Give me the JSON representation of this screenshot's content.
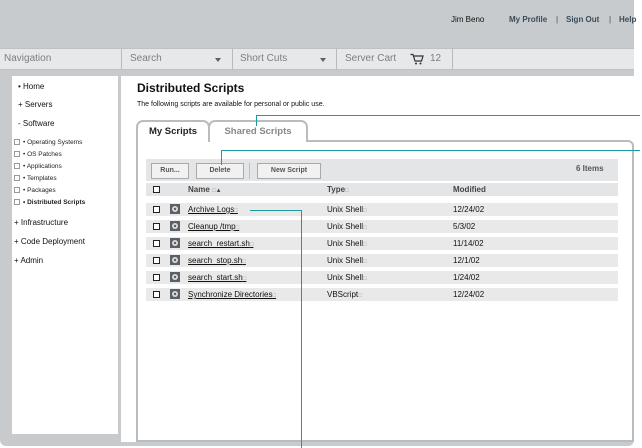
{
  "header": {
    "user_name": "Jim Beno",
    "my_profile": "My Profile",
    "separator": "|",
    "sign_out": "Sign Out",
    "help": "Help"
  },
  "navbar": {
    "navigation": "Navigation",
    "search": "Search",
    "shortcuts": "Short Cuts",
    "server_cart": "Server Cart",
    "cart_count": "12",
    "cart_icon": "shopping-cart-icon"
  },
  "sidebar": {
    "items": [
      {
        "label": "• Home"
      },
      {
        "label": "+ Servers"
      },
      {
        "label": "- Software"
      }
    ],
    "software_children": [
      {
        "label": "• Operating Systems"
      },
      {
        "label": "• OS Patches"
      },
      {
        "label": "• Applications"
      },
      {
        "label": "• Templates"
      },
      {
        "label": "• Packages"
      },
      {
        "label": "• Distributed Scripts",
        "selected": true
      }
    ],
    "more_items": [
      {
        "label": "+ Infrastructure"
      },
      {
        "label": "+ Code Deployment"
      },
      {
        "label": "+ Admin"
      }
    ]
  },
  "main": {
    "title": "Distributed Scripts",
    "description": "The following scripts are available for personal or public use.",
    "tabs": [
      {
        "label": "My Scripts",
        "active": true
      },
      {
        "label": "Shared Scripts",
        "active": false
      }
    ],
    "toolbar": {
      "run": "Run...",
      "delete": "Delete",
      "new_script": "New Script",
      "items_count": "6 Items"
    },
    "table": {
      "columns": [
        "Name",
        "Type",
        "Modified"
      ],
      "sort_indicator": "▲",
      "placeholder_glyph": "□",
      "rows": [
        {
          "name": "Archive Logs",
          "type": "Unix Shell",
          "modified": "12/24/02"
        },
        {
          "name": "Cleanup /tmp",
          "type": "Unix Shell",
          "modified": "5/3/02"
        },
        {
          "name": "search_restart.sh",
          "type": "Unix Shell",
          "modified": "11/14/02"
        },
        {
          "name": "search_stop.sh",
          "type": "Unix Shell",
          "modified": "12/1/02"
        },
        {
          "name": "search_start.sh",
          "type": "Unix Shell",
          "modified": "1/24/02"
        },
        {
          "name": "Synchronize Directories",
          "type": "VBScript",
          "modified": "12/24/02"
        }
      ]
    }
  },
  "colors": {
    "frame": "#c8cbcd",
    "callout": "#1a9aa3",
    "row_bg": "#e9e9ea"
  }
}
